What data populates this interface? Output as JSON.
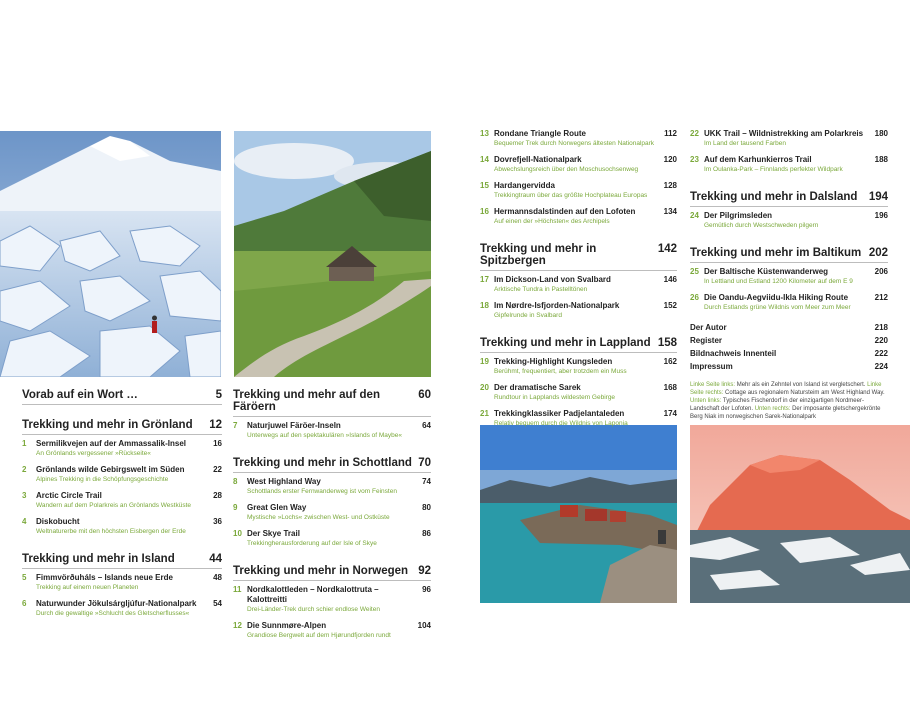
{
  "intro": {
    "title": "Vorab auf ein Wort …",
    "page": "5"
  },
  "col1": [
    {
      "section": "Trekking und mehr in Grönland",
      "page": "12",
      "entries": [
        {
          "num": "1",
          "title": "Sermilikvejen auf der Ammassalik-Insel",
          "page": "16",
          "sub": "An Grönlands vergessener »Rückseite«"
        },
        {
          "num": "2",
          "title": "Grönlands wilde Gebirgswelt im Süden",
          "page": "22",
          "sub": "Alpines Trekking in die Schöpfungsgeschichte"
        },
        {
          "num": "3",
          "title": "Arctic Circle Trail",
          "page": "28",
          "sub": "Wandern auf dem Polarkreis an Grönlands Westküste"
        },
        {
          "num": "4",
          "title": "Diskobucht",
          "page": "36",
          "sub": "Weltnaturerbe mit den höchsten Eisbergen der Erde"
        }
      ]
    },
    {
      "section": "Trekking und mehr in Island",
      "page": "44",
      "entries": [
        {
          "num": "5",
          "title": "Fimmvörðuháls – Islands neue Erde",
          "page": "48",
          "sub": "Trekking auf einem neuen Planeten"
        },
        {
          "num": "6",
          "title": "Naturwunder Jökulsárgljúfur-Nationalpark",
          "page": "54",
          "sub": "Durch die gewaltige »Schlucht des Gletscherflusses«"
        }
      ]
    }
  ],
  "col2": [
    {
      "section": "Trekking und mehr auf den Färöern",
      "page": "60",
      "entries": [
        {
          "num": "7",
          "title": "Naturjuwel Färöer-Inseln",
          "page": "64",
          "sub": "Unterwegs auf den spektakulären »Islands of Maybe«"
        }
      ]
    },
    {
      "section": "Trekking und mehr in Schottland",
      "page": "70",
      "entries": [
        {
          "num": "8",
          "title": "West Highland Way",
          "page": "74",
          "sub": "Schottlands erster Fernwanderweg ist vom Feinsten"
        },
        {
          "num": "9",
          "title": "Great Glen Way",
          "page": "80",
          "sub": "Mystische »Lochs« zwischen West- und Ostküste"
        },
        {
          "num": "10",
          "title": "Der Skye Trail",
          "page": "86",
          "sub": "Trekkingherausforderung auf der Isle of Skye"
        }
      ]
    },
    {
      "section": "Trekking und mehr in Norwegen",
      "page": "92",
      "entries": [
        {
          "num": "11",
          "title": "Nordkalottleden – Nordkalottruta – Kalottreitti",
          "page": "96",
          "sub": "Drei-Länder-Trek durch schier endlose Weiten"
        },
        {
          "num": "12",
          "title": "Die Sunnmøre-Alpen",
          "page": "104",
          "sub": "Grandiose Bergwelt auf dem Hjørundfjorden rundt"
        }
      ]
    }
  ],
  "col3": [
    {
      "section": "",
      "page": "",
      "entries": [
        {
          "num": "13",
          "title": "Rondane Triangle Route",
          "page": "112",
          "sub": "Bequemer Trek durch Norwegens ältesten Nationalpark"
        },
        {
          "num": "14",
          "title": "Dovrefjell-Nationalpark",
          "page": "120",
          "sub": "Abwechslungsreich über den Moschusochsenweg"
        },
        {
          "num": "15",
          "title": "Hardangervidda",
          "page": "128",
          "sub": "Trekkingtraum über das größte Hochplateau Europas"
        },
        {
          "num": "16",
          "title": "Hermannsdalstinden auf den Lofoten",
          "page": "134",
          "sub": "Auf einen der »Höchsten« des Archipels"
        }
      ]
    },
    {
      "section": "Trekking und mehr in Spitzbergen",
      "page": "142",
      "entries": [
        {
          "num": "17",
          "title": "Im Dickson-Land von Svalbard",
          "page": "146",
          "sub": "Arktische Tundra in Pastelltönen"
        },
        {
          "num": "18",
          "title": "Im Nørdre-Isfjorden-Nationalpark",
          "page": "152",
          "sub": "Gipfelrunde in Svalbard"
        }
      ]
    },
    {
      "section": "Trekking und mehr in Lappland",
      "page": "158",
      "entries": [
        {
          "num": "19",
          "title": "Trekking-Highlight Kungsleden",
          "page": "162",
          "sub": "Berühmt, frequentiert, aber trotzdem ein Muss"
        },
        {
          "num": "20",
          "title": "Der dramatische Sarek",
          "page": "168",
          "sub": "Rundtour in Lapplands wildestem Gebirge"
        },
        {
          "num": "21",
          "title": "Trekkingklassiker Padjelantaleden",
          "page": "174",
          "sub": "Relativ bequem durch die Wildnis von Laponia"
        }
      ]
    }
  ],
  "col4": [
    {
      "section": "",
      "page": "",
      "entries": [
        {
          "num": "22",
          "title": "UKK Trail – Wildnistrekking am Polarkreis",
          "page": "180",
          "sub": "Im Land der tausend Farben"
        },
        {
          "num": "23",
          "title": "Auf dem Karhunkierros Trail",
          "page": "188",
          "sub": "Im Oulanka-Park – Finnlands perfekter Wildpark"
        }
      ]
    },
    {
      "section": "Trekking und mehr in Dalsland",
      "page": "194",
      "entries": [
        {
          "num": "24",
          "title": "Der Pilgrimsleden",
          "page": "196",
          "sub": "Gemütlich durch Westschweden pilgern"
        }
      ]
    },
    {
      "section": "Trekking und mehr im Baltikum",
      "page": "202",
      "entries": [
        {
          "num": "25",
          "title": "Der Baltische Küstenwanderweg",
          "page": "206",
          "sub": "In Lettland und Estland 1200 Kilometer auf dem E 9"
        },
        {
          "num": "26",
          "title": "Die Oandu-Aegviidu-Ikla Hiking Route",
          "page": "212",
          "sub": "Durch Estlands grüne Wildnis vom Meer zum Meer"
        }
      ]
    }
  ],
  "extras": [
    {
      "title": "Der Autor",
      "page": "218"
    },
    {
      "title": "Register",
      "page": "220"
    },
    {
      "title": "Bildnachweis Innenteil",
      "page": "222"
    },
    {
      "title": "Impressum",
      "page": "224"
    }
  ],
  "caption": {
    "l1": "Linke Seite links:",
    "t1": " Mehr als ein Zehntel von Island ist vergletschert.",
    "l2": "Linke Seite rechts:",
    "t2": " Cottage aus regionalem Natursteim am West Highland Way.",
    "l3": "Unten links:",
    "t3": " Typisches Fischerdorf in der einzigartigen Nordmeer-Landschaft der Lofoten.",
    "l4": "Unten rechts:",
    "t4": " Der imposante gletschergekrönte Berg Niak im norwegischen Sarek-Nationalpark"
  }
}
